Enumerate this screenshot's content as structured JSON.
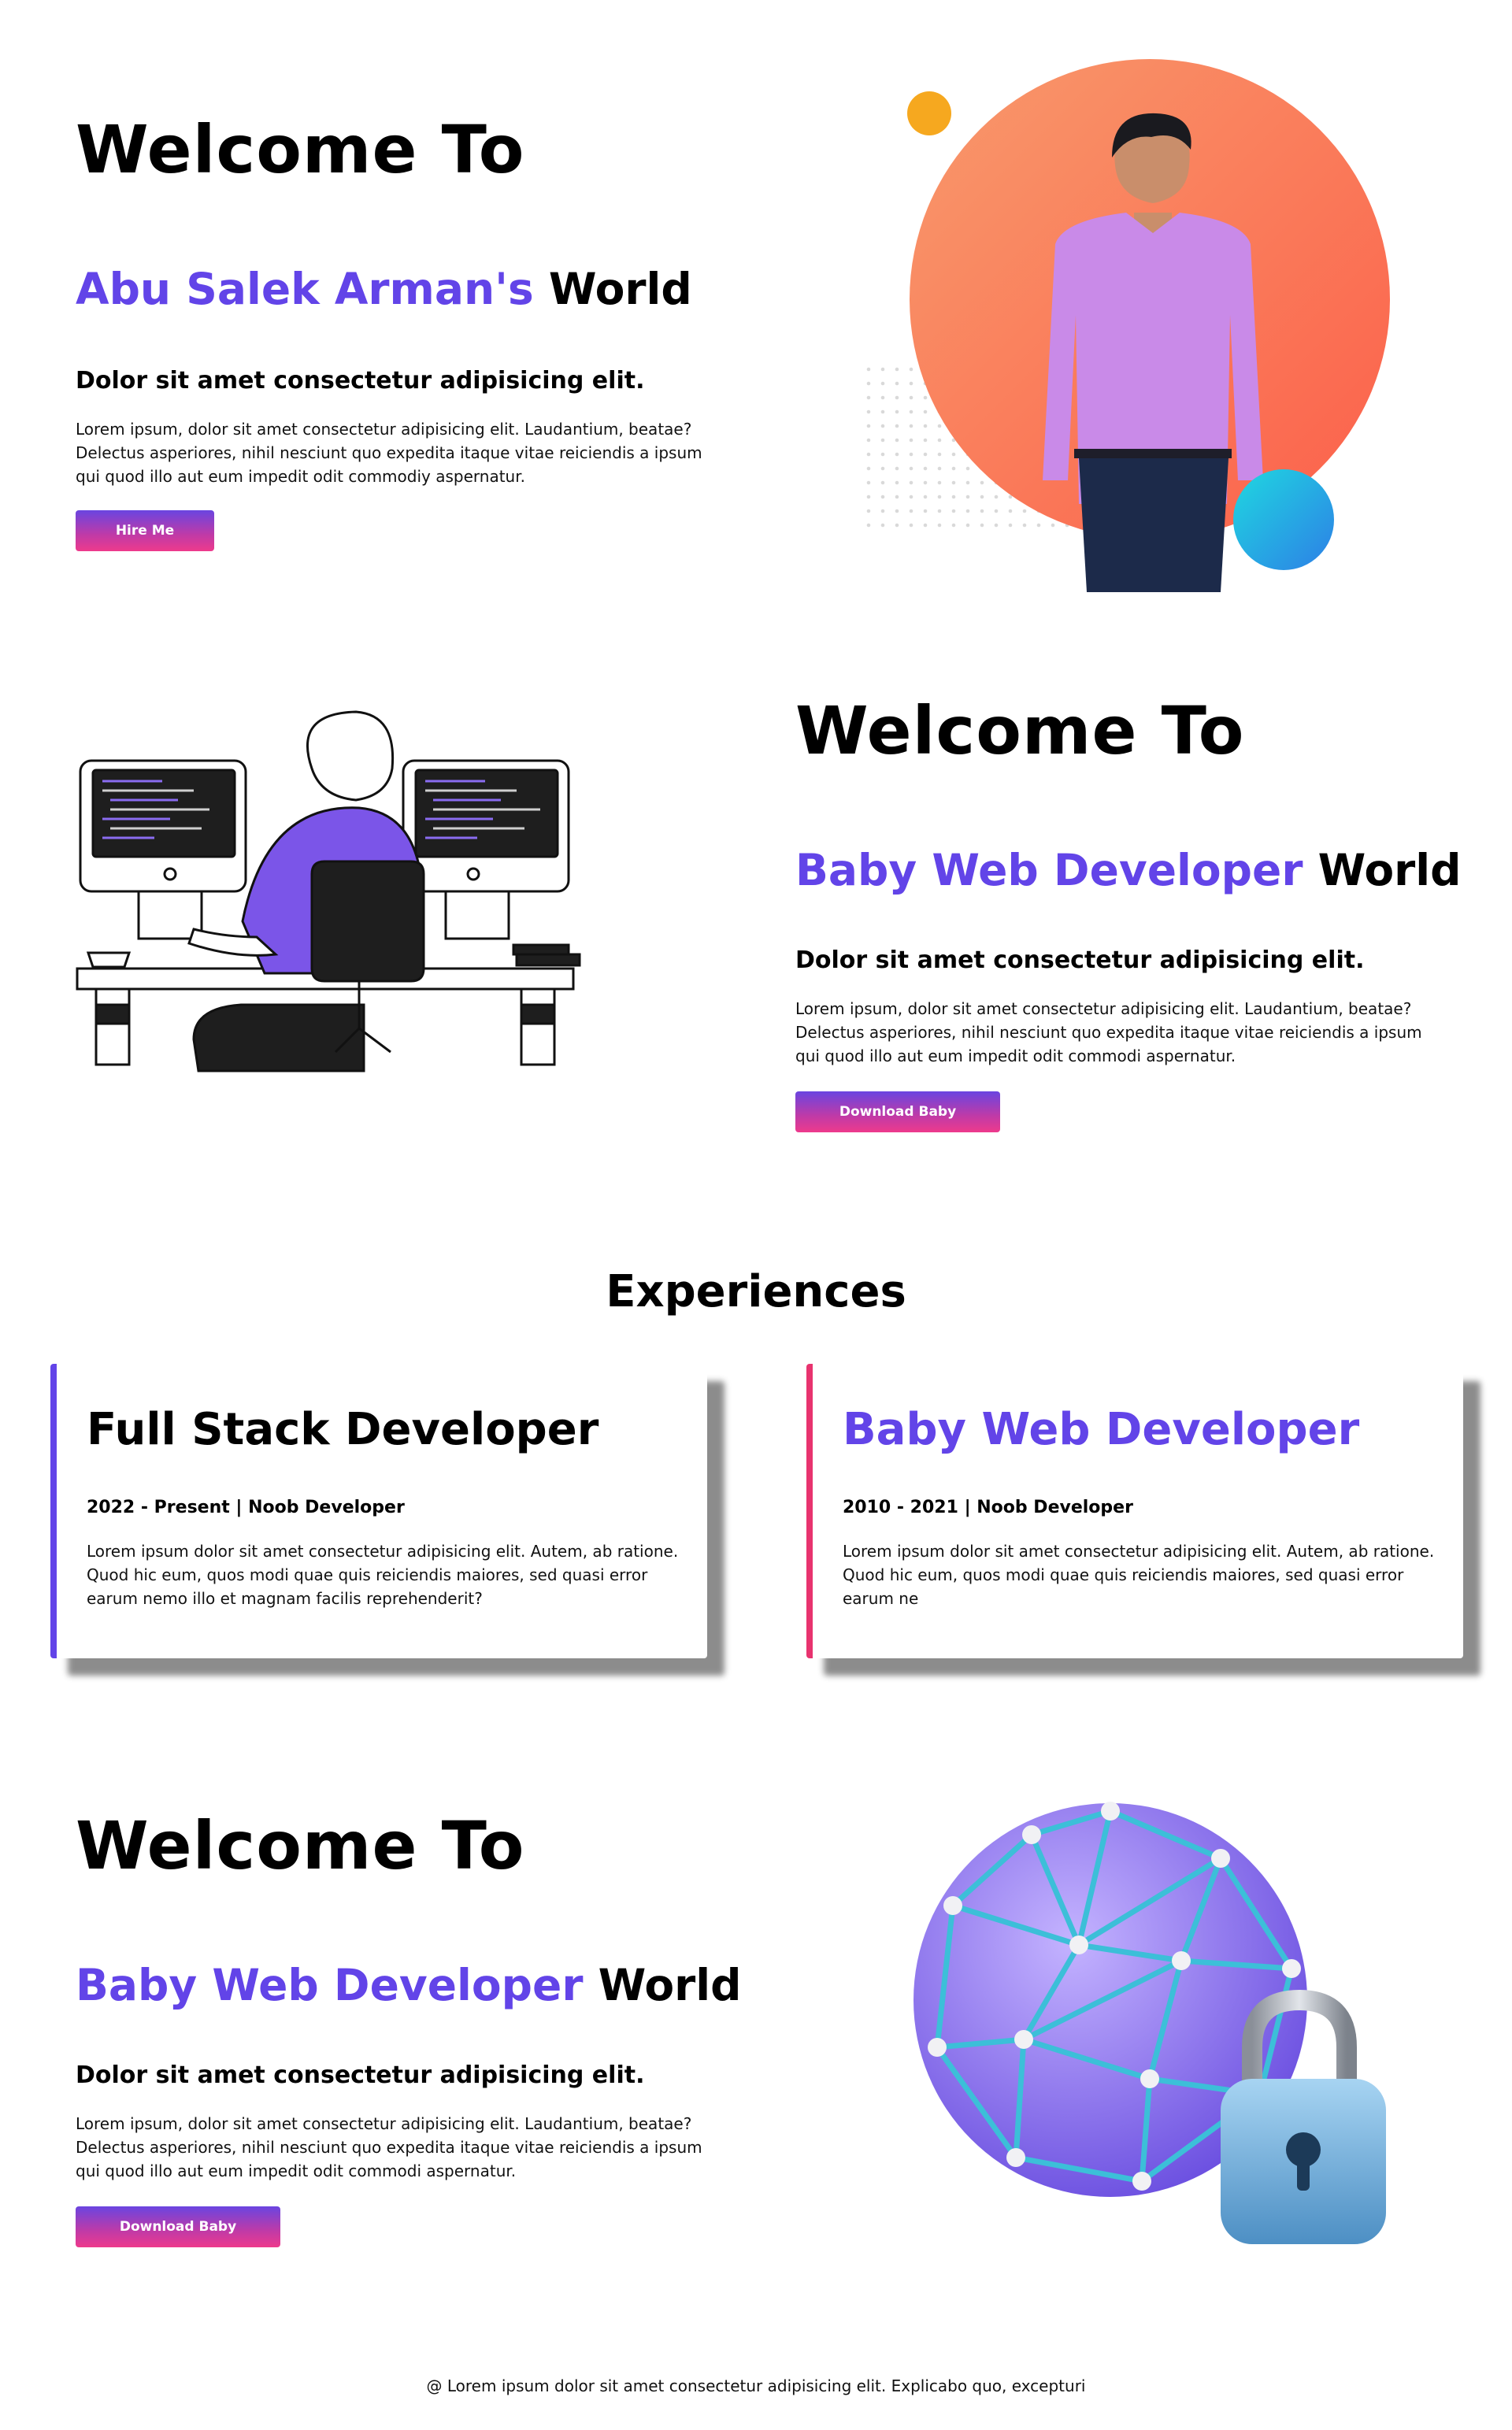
{
  "hero": {
    "welcome": "Welcome To",
    "name": "Abu Salek Arman's",
    "world": "World",
    "subheading": "Dolor sit amet consectetur adipisicing elit.",
    "paragraph": "Lorem ipsum, dolor sit amet consectetur adipisicing elit. Laudantium, beatae? Delectus asperiores, nihil nesciunt quo expedita itaque vitae reiciendis a ipsum qui quod illo aut eum impedit odit commodiy aspernatur.",
    "button_label": "Hire Me"
  },
  "section2": {
    "welcome": "Welcome To",
    "name": "Baby Web Developer",
    "world": "World",
    "subheading": "Dolor sit amet consectetur adipisicing elit.",
    "paragraph": "Lorem ipsum, dolor sit amet consectetur adipisicing elit. Laudantium, beatae? Delectus asperiores, nihil nesciunt quo expedita itaque vitae reiciendis a ipsum qui quod illo aut eum impedit odit commodi aspernatur.",
    "button_label": "Download Baby"
  },
  "experiences": {
    "title": "Experiences",
    "cards": [
      {
        "title": "Full Stack Developer",
        "dates": "2022 - Present | Noob Developer",
        "description": "Lorem ipsum dolor sit amet consectetur adipisicing elit. Autem, ab ratione. Quod hic eum, quos modi quae quis reiciendis maiores, sed quasi error earum nemo illo et magnam facilis reprehenderit?"
      },
      {
        "title": "Baby Web Developer",
        "dates": "2010 - 2021 | Noob Developer",
        "description": "Lorem ipsum dolor sit amet consectetur adipisicing elit. Autem, ab ratione. Quod hic eum, quos modi quae quis reiciendis maiores, sed quasi error earum ne"
      }
    ]
  },
  "section4": {
    "welcome": "Welcome To",
    "name": "Baby Web Developer",
    "world": "World",
    "subheading": "Dolor sit amet consectetur adipisicing elit.",
    "paragraph": "Lorem ipsum, dolor sit amet consectetur adipisicing elit. Laudantium, beatae? Delectus asperiores, nihil nesciunt quo expedita itaque vitae reiciendis a ipsum qui quod illo aut eum impedit odit commodi aspernatur.",
    "button_label": "Download Baby"
  },
  "footer": {
    "text": "@ Lorem ipsum dolor sit amet consectetur adipisicing elit. Explicabo quo, excepturi"
  },
  "colors": {
    "accent": "#6244e8",
    "card_border_1": "#6244e8",
    "card_border_2": "#e8336f",
    "button_gradient_top": "#6a45e0",
    "button_gradient_bottom": "#ee3a8c"
  },
  "images": {
    "hero": "profile-photo",
    "section2": "developer-at-desk-illustration",
    "section4": "network-sphere-with-lock-illustration"
  }
}
